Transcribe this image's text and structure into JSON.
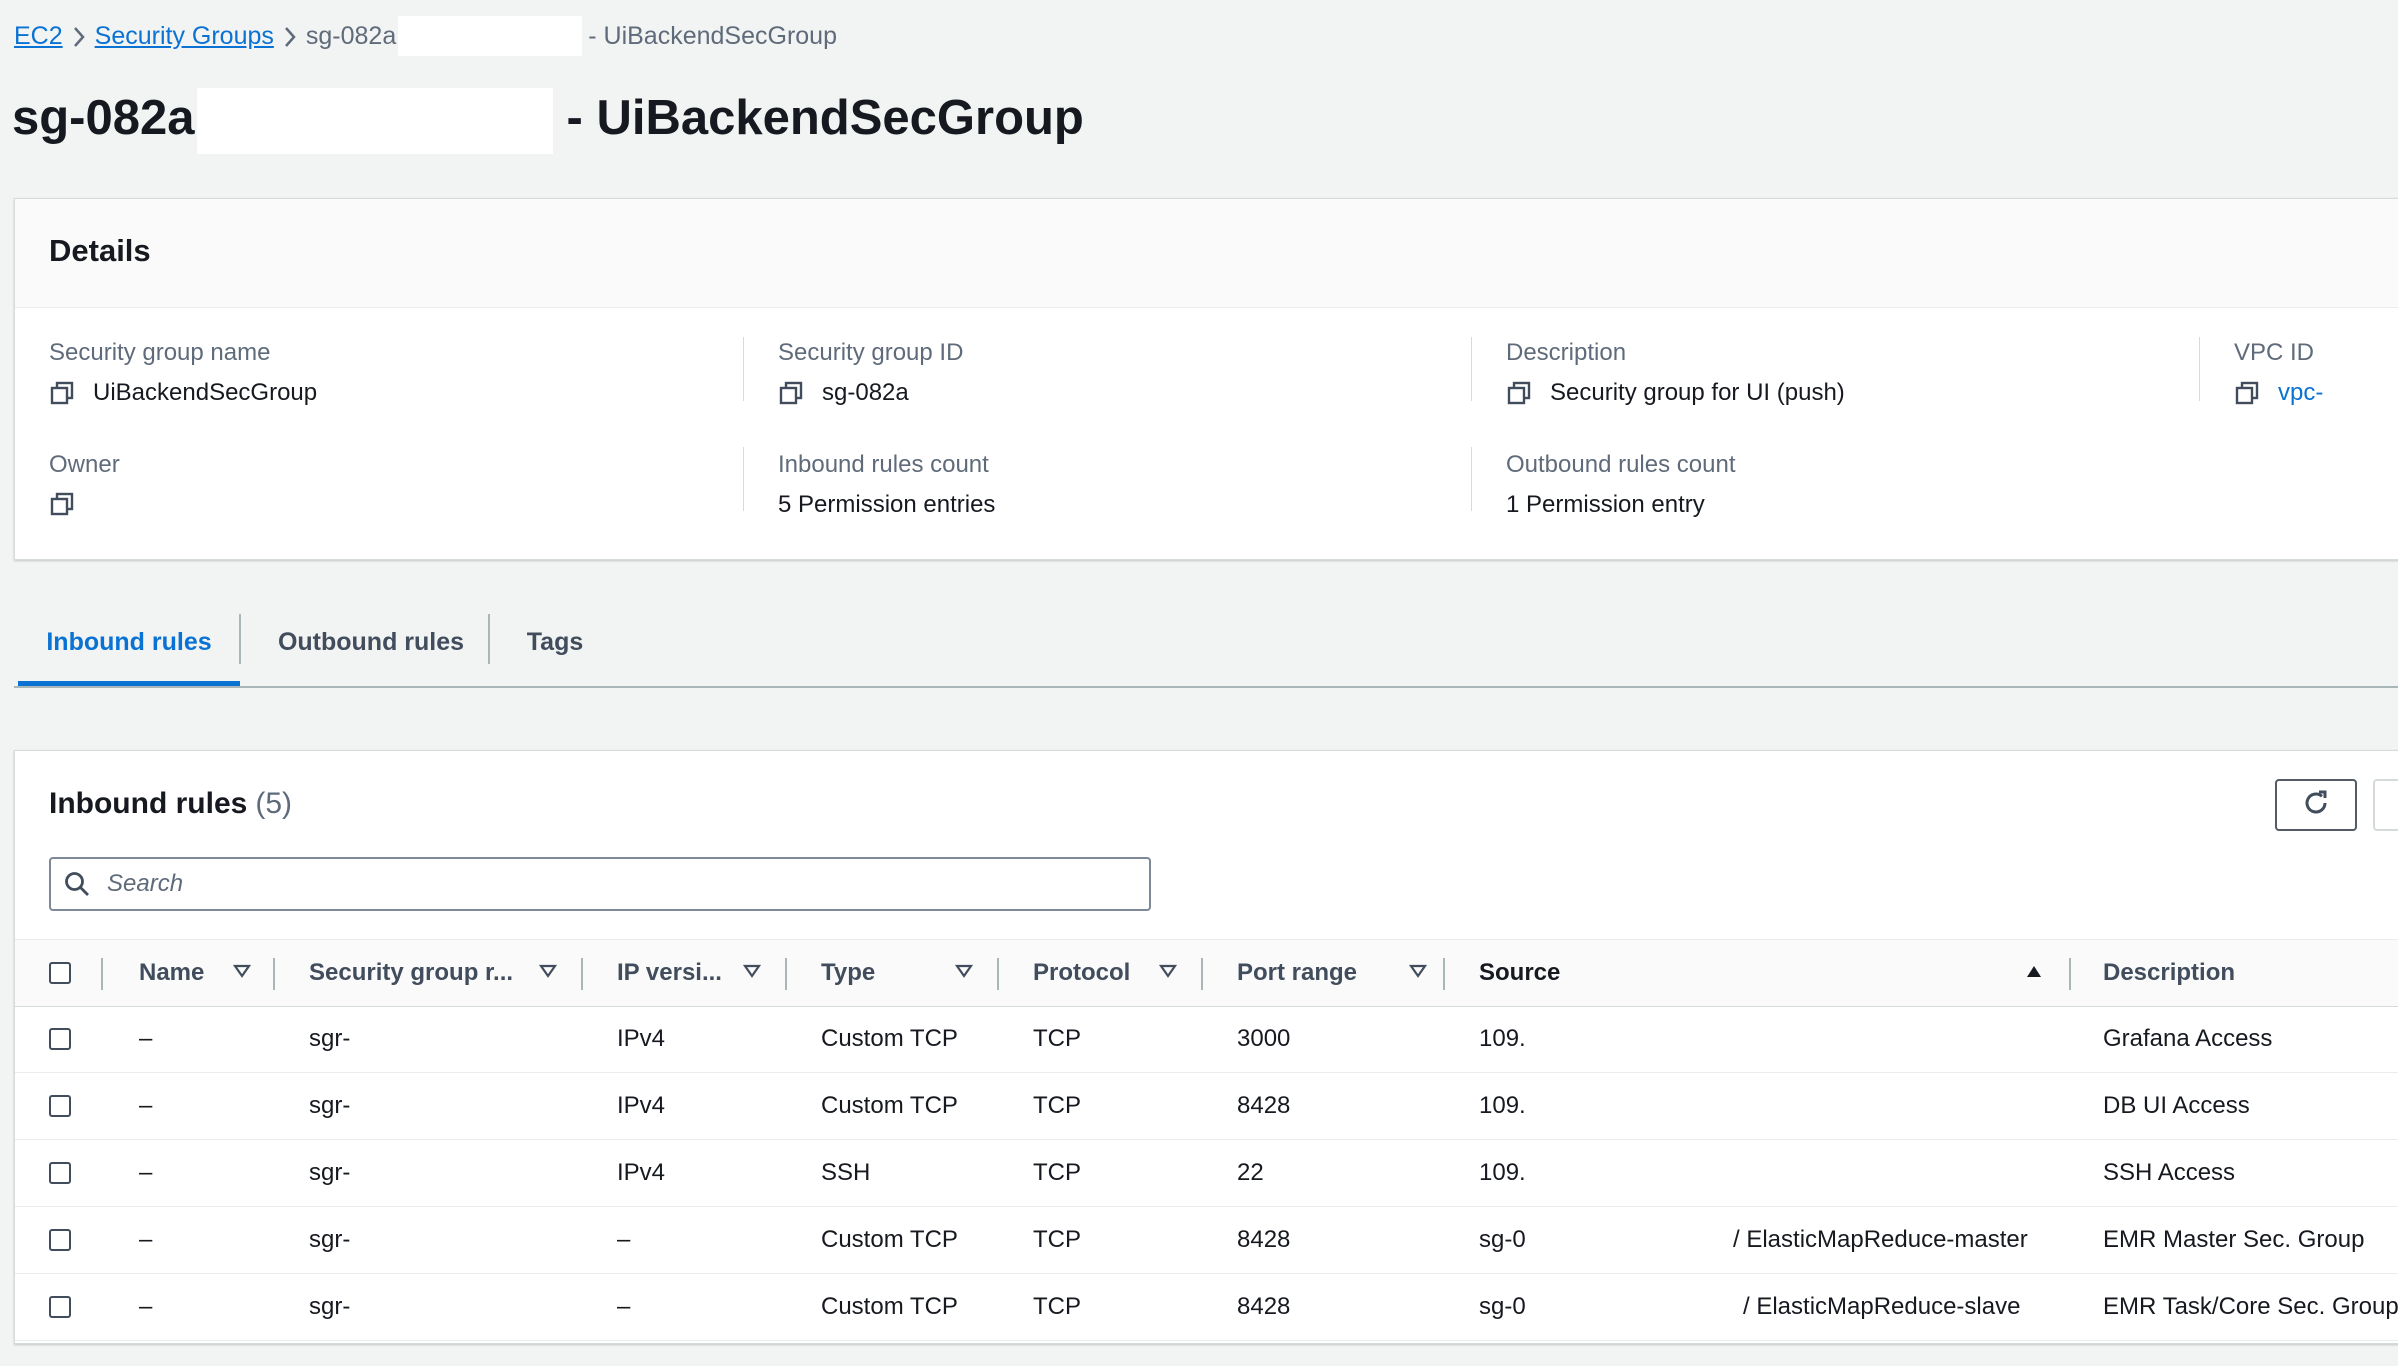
{
  "breadcrumb": {
    "items": [
      {
        "label": "EC2"
      },
      {
        "label": "Security Groups"
      }
    ],
    "current_prefix": "sg-082a",
    "current_suffix": "- UiBackendSecGroup"
  },
  "page": {
    "title_prefix": "sg-082a",
    "title_suffix": "- UiBackendSecGroup"
  },
  "details": {
    "title": "Details",
    "fields": {
      "sg_name": {
        "label": "Security group name",
        "value": "UiBackendSecGroup"
      },
      "sg_id": {
        "label": "Security group ID",
        "value": "sg-082a"
      },
      "description": {
        "label": "Description",
        "value": "Security group for UI (push)"
      },
      "vpc_id": {
        "label": "VPC ID",
        "value": "vpc-"
      },
      "owner": {
        "label": "Owner",
        "value": ""
      },
      "inbound_count": {
        "label": "Inbound rules count",
        "value": "5 Permission entries"
      },
      "outbound_count": {
        "label": "Outbound rules count",
        "value": "1 Permission entry"
      }
    }
  },
  "tabs": [
    {
      "label": "Inbound rules",
      "active": true
    },
    {
      "label": "Outbound rules",
      "active": false
    },
    {
      "label": "Tags",
      "active": false
    }
  ],
  "inbound": {
    "title": "Inbound rules",
    "count": "(5)",
    "search_placeholder": "Search",
    "columns": [
      "Name",
      "Security group r...",
      "IP versi...",
      "Type",
      "Protocol",
      "Port range",
      "Source",
      "Description"
    ],
    "rows": [
      {
        "name": "–",
        "sgr": "sgr-",
        "ipv": "IPv4",
        "type": "Custom TCP",
        "protocol": "TCP",
        "port": "3000",
        "source": "109.",
        "source_extra": "",
        "description": "Grafana Access"
      },
      {
        "name": "–",
        "sgr": "sgr-",
        "ipv": "IPv4",
        "type": "Custom TCP",
        "protocol": "TCP",
        "port": "8428",
        "source": "109.",
        "source_extra": "",
        "description": "DB UI Access"
      },
      {
        "name": "–",
        "sgr": "sgr-",
        "ipv": "IPv4",
        "type": "SSH",
        "protocol": "TCP",
        "port": "22",
        "source": "109.",
        "source_extra": "",
        "description": "SSH Access"
      },
      {
        "name": "–",
        "sgr": "sgr-",
        "ipv": "–",
        "type": "Custom TCP",
        "protocol": "TCP",
        "port": "8428",
        "source": "sg-0",
        "source_extra": "/ ElasticMapReduce-master",
        "description": "EMR Master Sec. Group"
      },
      {
        "name": "–",
        "sgr": "sgr-",
        "ipv": "–",
        "type": "Custom TCP",
        "protocol": "TCP",
        "port": "8428",
        "source": "sg-0",
        "source_extra": "/ ElasticMapReduce-slave",
        "description": "EMR Task/Core Sec. Group"
      }
    ]
  },
  "colors": {
    "link": "#0972d3",
    "page_bg": "#f2f3f3",
    "text": "#16191f",
    "muted": "#5f6b7a"
  },
  "icons": {
    "copy": "copy-icon",
    "search": "search-icon",
    "refresh": "refresh-icon",
    "chevron": "chevron-right-icon",
    "sort": "sort-caret-icon"
  }
}
